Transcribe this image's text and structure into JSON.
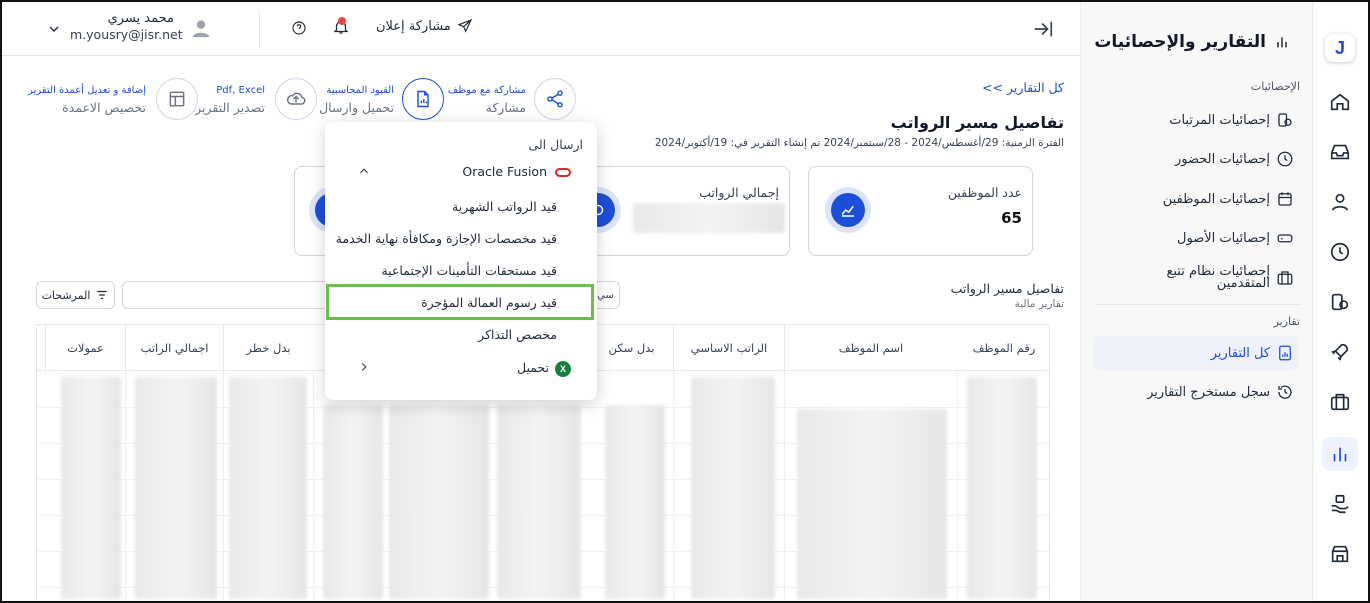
{
  "header": {
    "share_announcement": "مشاركة إعلان",
    "user_name": "محمد يسري",
    "user_email": "m.yousry@jisr.net"
  },
  "sidebar": {
    "title": "التقارير والإحصائيات",
    "stats_section": "الإحصائيات",
    "stats_items": [
      {
        "label": "إحصائيات المرتبات"
      },
      {
        "label": "إحصائيات الحضور"
      },
      {
        "label": "إحصائيات الموظفين"
      },
      {
        "label": "إحصائيات الأصول"
      },
      {
        "label": "إحصائيات نظام تتبع",
        "label2": "المتقدمين"
      }
    ],
    "reports_section": "تقارير",
    "reports_items": [
      {
        "label": "كل التقارير"
      },
      {
        "label": "سجل مستخرج التقارير"
      }
    ]
  },
  "actions": {
    "share": {
      "top": "مشاركة مع موظف",
      "bottom": "مشاركة"
    },
    "entries": {
      "top": "القيود المحاسبية",
      "bottom": "تحميل وارسال"
    },
    "export": {
      "top": "Pdf, Excel",
      "bottom": "تصدير التقرير"
    },
    "columns": {
      "top": "إضافة و تعديل أعمدة التقرير",
      "bottom": "تخصيص الاعمدة"
    }
  },
  "page": {
    "breadcrumb": "<< كل التقارير",
    "title": "تفاصيل مسير الرواتب",
    "period": "الفترة الزمنية: 29/أغسطس/2024 - 28/سبتمبر/2024 تم إنشاء التقرير في: 19/أكتوبر/2024"
  },
  "cards": {
    "employees_label": "عدد الموظفين",
    "employees_value": "65",
    "salaries_label": "إجمالي الرواتب"
  },
  "table": {
    "title": "تفاصيل مسير الرواتب",
    "subtitle": "تقارير مالية",
    "filters_label": "المرشحات",
    "small_btn": "سي",
    "headers": {
      "emp_no": "رقم الموظف",
      "emp_name": "اسم الموظف",
      "basic": "الراتب الاساسي",
      "housing": "بدل سكن",
      "risk": "بدل خطر",
      "total": "اجمالي الراتب",
      "commissions": "عمولات"
    }
  },
  "dropdown": {
    "send_to": "ارسال الى",
    "oracle": "Oracle Fusion",
    "items": [
      {
        "label": "قيد الرواتب الشهرية"
      },
      {
        "label": "قيد مخصصات الإجازة ومكافأة نهاية الخدمة"
      },
      {
        "label": "قيد مستحقات التأمينات الإجتماعية"
      },
      {
        "label": "قيد رسوم العمالة المؤجرة"
      },
      {
        "label": "مخصص التذاكر"
      }
    ],
    "download": "تحميل"
  }
}
